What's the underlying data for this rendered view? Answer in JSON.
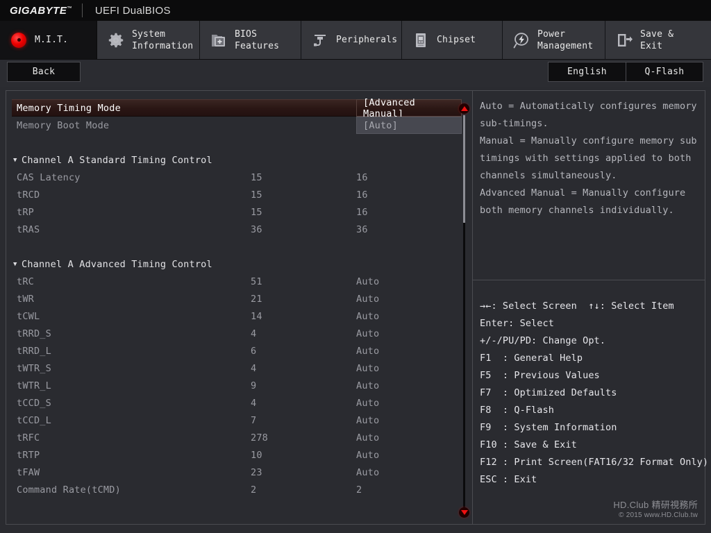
{
  "brand": {
    "logo": "GIGABYTE",
    "tm": "™",
    "subtitle": "UEFI DualBIOS"
  },
  "tabs": [
    {
      "id": "mit",
      "label": "M.I.T.",
      "icon": "red-orb-icon",
      "active": true
    },
    {
      "id": "sysinfo",
      "label": "System\nInformation",
      "icon": "gear-icon",
      "active": false
    },
    {
      "id": "bios",
      "label": "BIOS\nFeatures",
      "icon": "folder-plus-icon",
      "active": false
    },
    {
      "id": "periph",
      "label": "Peripherals",
      "icon": "plug-icon",
      "active": false
    },
    {
      "id": "chipset",
      "label": "Chipset",
      "icon": "chip-icon",
      "active": false
    },
    {
      "id": "power",
      "label": "Power\nManagement",
      "icon": "lightning-icon",
      "active": false
    },
    {
      "id": "saveexit",
      "label": "Save & Exit",
      "icon": "exit-door-icon",
      "active": false
    }
  ],
  "subbar": {
    "back": "Back",
    "language": "English",
    "qflash": "Q-Flash"
  },
  "settings": {
    "rows": [
      {
        "type": "item",
        "label": "Memory Timing Mode",
        "v1": "",
        "v2": "[Advanced Manual]",
        "selected": true,
        "boxed": "sel"
      },
      {
        "type": "item",
        "label": "Memory Boot Mode",
        "v1": "",
        "v2": "[Auto]",
        "selected": false,
        "boxed": "alt"
      },
      {
        "type": "spacer"
      },
      {
        "type": "header",
        "label": "Channel A Standard Timing Control",
        "triangle": "▼"
      },
      {
        "type": "item",
        "label": "CAS Latency",
        "v1": "15",
        "v2": "16"
      },
      {
        "type": "item",
        "label": "tRCD",
        "v1": "15",
        "v2": "16"
      },
      {
        "type": "item",
        "label": "tRP",
        "v1": "15",
        "v2": "16"
      },
      {
        "type": "item",
        "label": "tRAS",
        "v1": "36",
        "v2": "36"
      },
      {
        "type": "spacer"
      },
      {
        "type": "header",
        "label": "Channel A Advanced Timing Control",
        "triangle": "▼"
      },
      {
        "type": "item",
        "label": "tRC",
        "v1": "51",
        "v2": "Auto"
      },
      {
        "type": "item",
        "label": "tWR",
        "v1": "21",
        "v2": "Auto"
      },
      {
        "type": "item",
        "label": "tCWL",
        "v1": "14",
        "v2": "Auto"
      },
      {
        "type": "item",
        "label": "tRRD_S",
        "v1": "4",
        "v2": "Auto"
      },
      {
        "type": "item",
        "label": "tRRD_L",
        "v1": "6",
        "v2": "Auto"
      },
      {
        "type": "item",
        "label": "tWTR_S",
        "v1": "4",
        "v2": "Auto"
      },
      {
        "type": "item",
        "label": "tWTR_L",
        "v1": "9",
        "v2": "Auto"
      },
      {
        "type": "item",
        "label": "tCCD_S",
        "v1": "4",
        "v2": "Auto"
      },
      {
        "type": "item",
        "label": "tCCD_L",
        "v1": "7",
        "v2": "Auto"
      },
      {
        "type": "item",
        "label": "tRFC",
        "v1": "278",
        "v2": "Auto"
      },
      {
        "type": "item",
        "label": "tRTP",
        "v1": "10",
        "v2": "Auto"
      },
      {
        "type": "item",
        "label": "tFAW",
        "v1": "23",
        "v2": "Auto"
      },
      {
        "type": "item",
        "label": "Command Rate(tCMD)",
        "v1": "2",
        "v2": "2"
      }
    ]
  },
  "scrollbar": {
    "up_arrow": "▲",
    "down_arrow": "▼"
  },
  "help": {
    "lines": [
      "Auto = Automatically configures memory",
      "sub-timings.",
      "Manual = Manually configure memory sub",
      "timings with settings applied to both",
      "channels simultaneously.",
      "Advanced Manual = Manually configure",
      "both memory channels individually."
    ]
  },
  "keys": {
    "lines": [
      "→←: Select Screen  ↑↓: Select Item",
      "Enter: Select",
      "+/-/PU/PD: Change Opt.",
      "F1  : General Help",
      "F5  : Previous Values",
      "F7  : Optimized Defaults",
      "F8  : Q-Flash",
      "F9  : System Information",
      "F10 : Save & Exit",
      "F12 : Print Screen(FAT16/32 Format Only)",
      "ESC : Exit"
    ]
  },
  "watermark": {
    "line1": "HD.Club 精研視務所",
    "line2": "© 2015  www.HD.Club.tw"
  },
  "colors": {
    "accent_red": "#ee0000",
    "panel_bg": "#2a2b30",
    "border": "#4b4c51",
    "selected_row": "#2a1614",
    "text_dim": "#9a9ba2",
    "text_bright": "#e6e6ea"
  }
}
